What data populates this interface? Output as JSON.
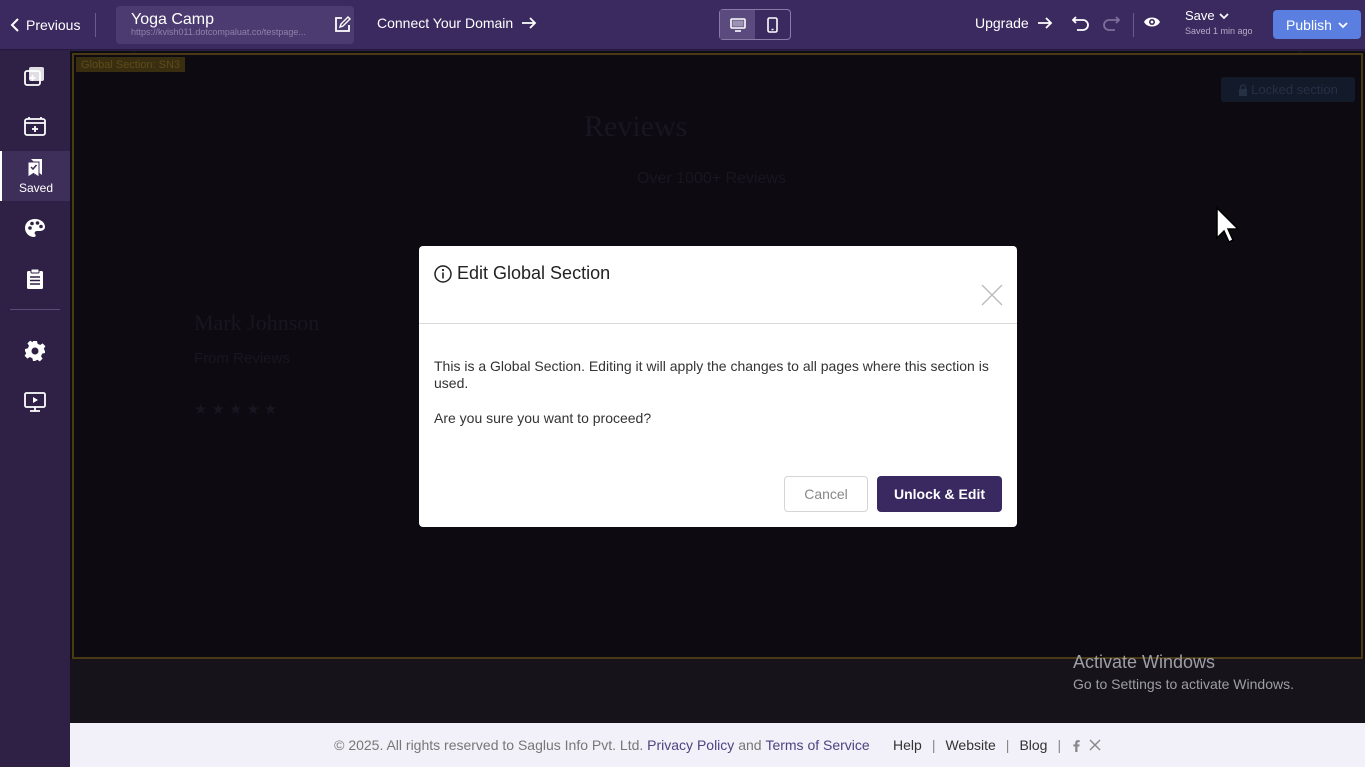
{
  "topbar": {
    "previous_label": "Previous",
    "site_name": "Yoga Camp",
    "site_url": "https://kvish011.dotcompaluat.co/testpage...",
    "connect_domain_label": "Connect Your Domain",
    "upgrade_label": "Upgrade",
    "save_label": "Save",
    "saved_status": "Saved 1 min ago",
    "publish_label": "Publish"
  },
  "sidebar": {
    "items": [
      {
        "name": "add-page",
        "label": ""
      },
      {
        "name": "sections",
        "label": ""
      },
      {
        "name": "saved",
        "label": "Saved"
      },
      {
        "name": "theme",
        "label": ""
      },
      {
        "name": "forms",
        "label": ""
      },
      {
        "name": "settings",
        "label": ""
      },
      {
        "name": "preview",
        "label": ""
      }
    ]
  },
  "canvas": {
    "global_section_label": "Global Section: SN3",
    "locked_label": "Locked section",
    "heading": "Reviews",
    "subheading": "Over 1000+ Reviews",
    "reviewer_name": "Mark Johnson",
    "reviewer_meta": "From Reviews",
    "stars": "★★★★★"
  },
  "modal": {
    "title": "Edit Global Section",
    "message": "This is a Global Section. Editing it will apply the changes to all pages where this section is used.",
    "question": "Are you sure you want to proceed?",
    "cancel_label": "Cancel",
    "confirm_label": "Unlock & Edit"
  },
  "watermark": {
    "line1": "Activate Windows",
    "line2": "Go to Settings to activate Windows."
  },
  "footer": {
    "copyright": "©  2025. All rights reserved to Saglus Info Pvt. Ltd.",
    "privacy": "Privacy Policy",
    "and": "and",
    "terms": "Terms of Service",
    "help": "Help",
    "website": "Website",
    "blog": "Blog",
    "sep": "|"
  },
  "colors": {
    "topbar_bg": "#3b2a5f",
    "sidebar_bg": "#2e2145",
    "publish_bg": "#5b7fe0",
    "primary_button": "#3a2960"
  }
}
